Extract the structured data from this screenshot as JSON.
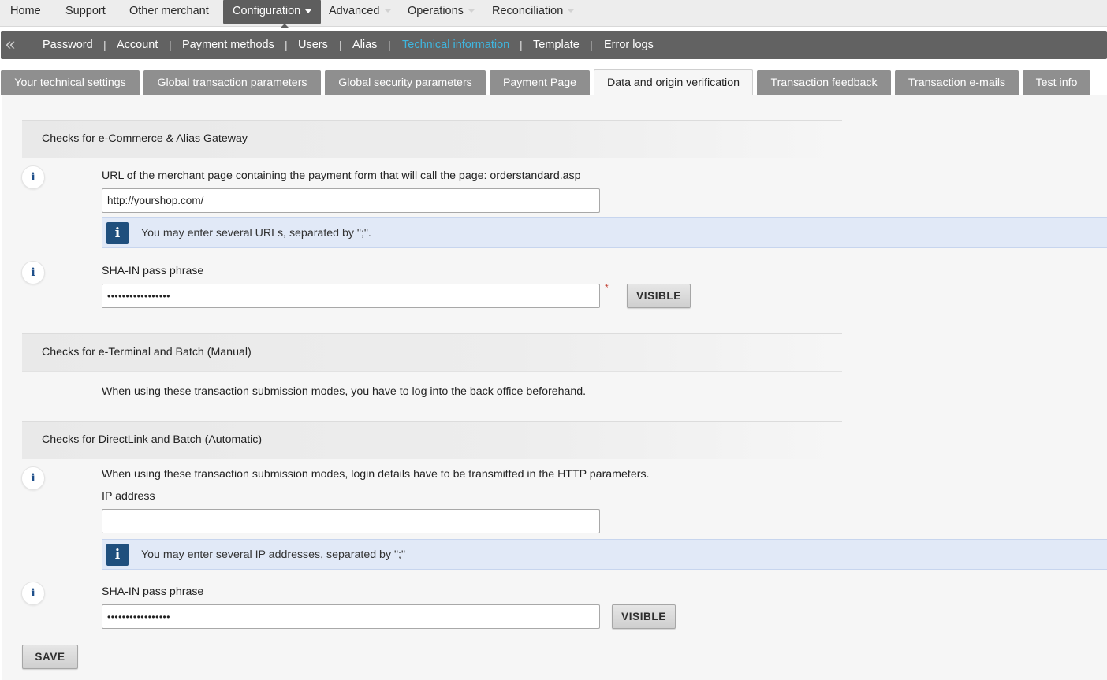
{
  "top_menu": {
    "home": "Home",
    "support": "Support",
    "other_merchant": "Other merchant",
    "configuration": "Configuration",
    "advanced": "Advanced",
    "operations": "Operations",
    "reconciliation": "Reconciliation"
  },
  "sub_nav": {
    "back_icon": "«",
    "items": [
      "Password",
      "Account",
      "Payment methods",
      "Users",
      "Alias",
      "Technical information",
      "Template",
      "Error logs"
    ],
    "separator": "|",
    "current": "Technical information",
    "current_color": "#3fb6df"
  },
  "tabs": {
    "items": [
      "Your technical settings",
      "Global transaction parameters",
      "Global security parameters",
      "Payment Page",
      "Data and origin verification",
      "Transaction feedback",
      "Transaction e-mails",
      "Test info"
    ],
    "active": "Data and origin verification"
  },
  "info_glyph": "i",
  "section_ecommerce": {
    "title": "Checks for e-Commerce & Alias Gateway",
    "url_label": "URL of the merchant page containing the payment form that will call the page: orderstandard.asp",
    "url_value": "http://yourshop.com/",
    "url_hint": "You may enter several URLs, separated by \";\".",
    "sha_label": "SHA-IN pass phrase",
    "sha_value": "•••••••••••••••••",
    "required_mark": "*",
    "visible_button": "VISIBLE"
  },
  "section_eterminal": {
    "title": "Checks for e-Terminal and Batch (Manual)",
    "text": "When using these transaction submission modes, you have to log into the back office beforehand."
  },
  "section_directlink": {
    "title": "Checks for DirectLink and Batch (Automatic)",
    "text": "When using these transaction submission modes, login details have to be transmitted in the HTTP parameters.",
    "ip_label": "IP address",
    "ip_value": "",
    "ip_hint": "You may enter several IP addresses, separated by \";\"",
    "sha_label": "SHA-IN pass phrase",
    "sha_value": "•••••••••••••••••",
    "visible_button": "VISIBLE"
  },
  "save_button": "SAVE"
}
